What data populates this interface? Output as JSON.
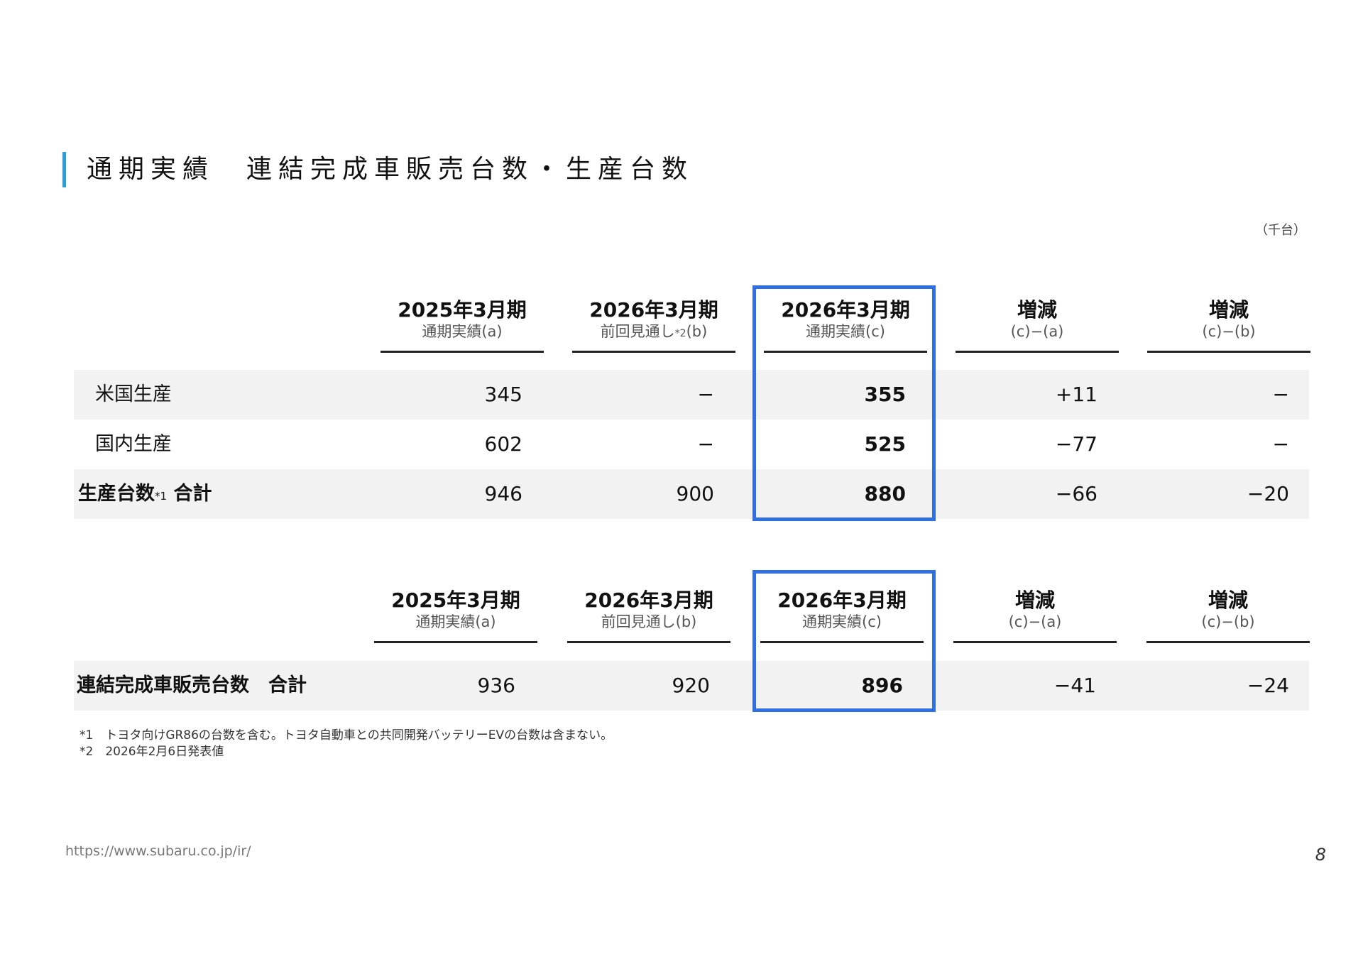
{
  "page_title": "通期実績　連結完成車販売台数・生産台数",
  "unit": "（千台）",
  "table1": {
    "headers": [
      {
        "l1": "2025年3月期",
        "l2": "通期実績(a)",
        "l2_sup": "",
        "l2_tail": ""
      },
      {
        "l1": "2026年3月期",
        "l2": "前回見通し",
        "l2_sup": "*2",
        "l2_tail": "(b)"
      },
      {
        "l1": "2026年3月期",
        "l2": "通期実績(c)",
        "l2_sup": "",
        "l2_tail": ""
      },
      {
        "l1": "増減",
        "l2": "(c)−(a)",
        "l2_sup": "",
        "l2_tail": ""
      },
      {
        "l1": "増減",
        "l2": "(c)−(b)",
        "l2_sup": "",
        "l2_tail": ""
      }
    ],
    "rows": [
      {
        "label": "米国生産",
        "label_sup": "",
        "label_tail": "",
        "values": [
          "345",
          "−",
          "355",
          "+11",
          "−"
        ]
      },
      {
        "label": "国内生産",
        "label_sup": "",
        "label_tail": "",
        "values": [
          "602",
          "−",
          "525",
          "−77",
          "−"
        ]
      },
      {
        "label": "生産台数",
        "label_sup": "*1",
        "label_tail": " 合計",
        "values": [
          "946",
          "900",
          "880",
          "−66",
          "−20"
        ]
      }
    ]
  },
  "table2": {
    "headers": [
      {
        "l1": "2025年3月期",
        "l2": "通期実績(a)"
      },
      {
        "l1": "2026年3月期",
        "l2": "前回見通し(b)"
      },
      {
        "l1": "2026年3月期",
        "l2": "通期実績(c)"
      },
      {
        "l1": "増減",
        "l2": "(c)−(a)"
      },
      {
        "l1": "増減",
        "l2": "(c)−(b)"
      }
    ],
    "rows": [
      {
        "label": "連結完成車販売台数　合計",
        "values": [
          "936",
          "920",
          "896",
          "−41",
          "−24"
        ]
      }
    ]
  },
  "notes": [
    "*1　トヨタ向けGR86の台数を含む。トヨタ自動車との共同開発バッテリーEVの台数は含まない。",
    "*2　2026年2月6日発表値"
  ],
  "footer_url": "https://www.subaru.co.jp/ir/",
  "page_number": "8",
  "colors": {
    "accent": "#2a9fd6",
    "highlight": "#2f6fe0",
    "row_shade": "#f2f2f2"
  }
}
